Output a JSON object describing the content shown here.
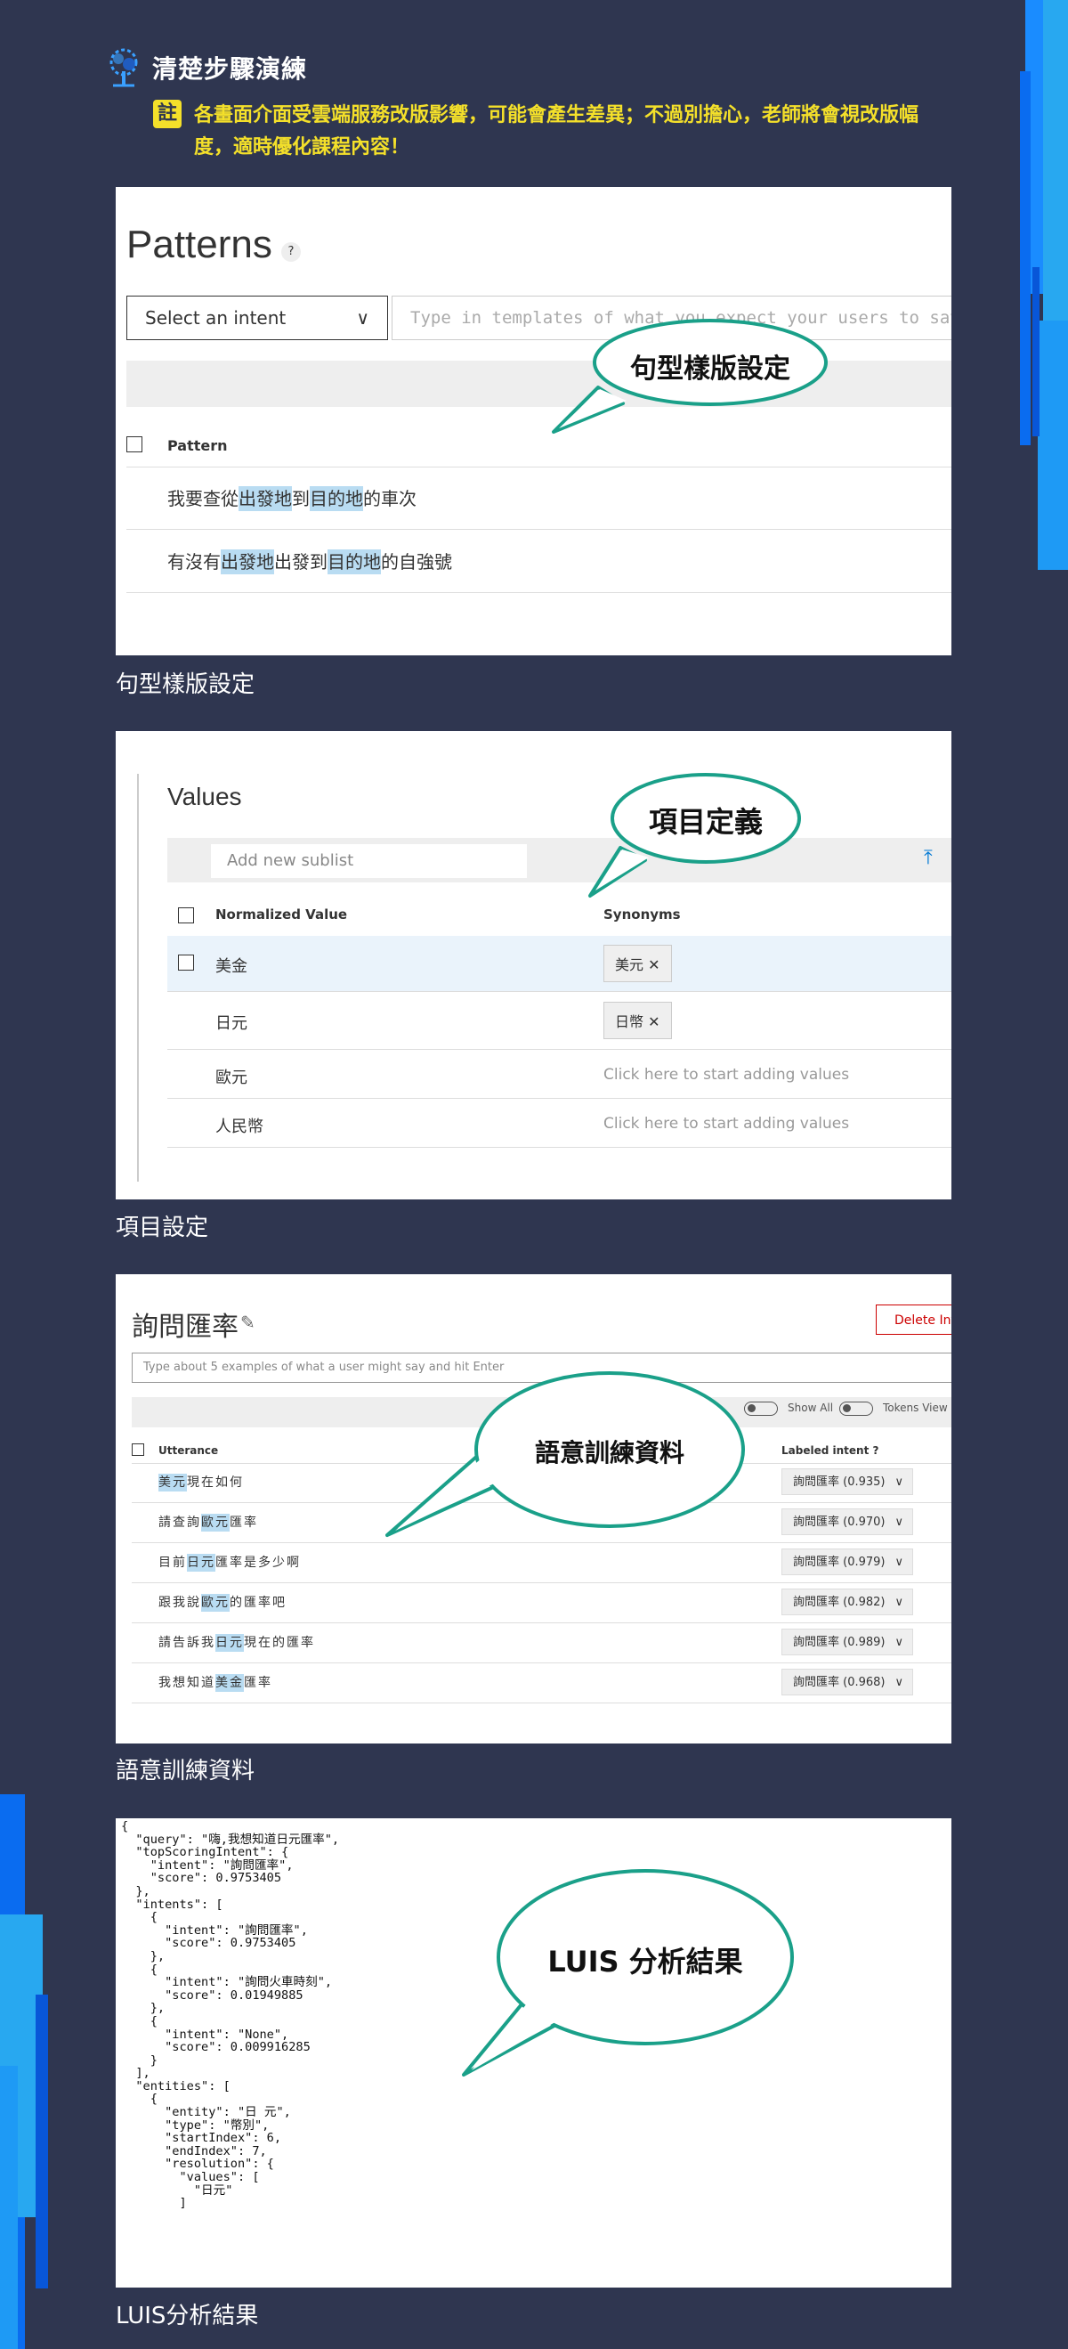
{
  "header": {
    "title": "清楚步驟演練",
    "note_badge": "註",
    "note_text": "各畫面介面受雲端服務改版影響，可能會產生差異；不過別擔心，老師將會視改版幅度，適時優化課程內容！"
  },
  "colors": {
    "background": "#2f3650",
    "accent_yellow": "#f4e02a",
    "bubble_border": "#1aa089",
    "deco_blue": "#0a6cf0"
  },
  "sections": [
    {
      "caption": "句型樣版設定",
      "bubble": "句型樣版設定",
      "screen": {
        "title": "Patterns",
        "help": "?",
        "select": "Select an intent",
        "input_placeholder": "Type in templates of what you expect your users to say",
        "column": "Pattern",
        "rows": [
          {
            "pre": "我要查從",
            "e1": "出發地",
            "mid": "到",
            "e2": "目的地",
            "post": "的車次"
          },
          {
            "pre": "有沒有",
            "e1": "出發地",
            "mid": "出發到",
            "e2": "目的地",
            "post": "的自強號"
          }
        ]
      }
    },
    {
      "caption": "項目設定",
      "bubble": "項目定義",
      "screen": {
        "title": "Values",
        "add_placeholder": "Add new sublist",
        "col_value": "Normalized Value",
        "col_syn": "Synonyms",
        "rows": [
          {
            "value": "美金",
            "synonym": "美元"
          },
          {
            "value": "日元",
            "synonym": "日幣"
          },
          {
            "value": "歐元",
            "placeholder": "Click here to start adding values"
          },
          {
            "value": "人民幣",
            "placeholder": "Click here to start adding values"
          }
        ]
      }
    },
    {
      "caption": "語意訓練資料",
      "bubble": "語意訓練資料",
      "screen": {
        "title": "詢問匯率",
        "delete": "Delete Inte",
        "input_placeholder": "Type about 5 examples of what a user might say and hit Enter",
        "show_all": "Show All",
        "tokens_view": "Tokens View",
        "col_utterance": "Utterance",
        "col_label": "Labeled intent",
        "rows": [
          {
            "pre": "",
            "e": "美元",
            "post": "現在如何",
            "label": "詢問匯率 (0.935)"
          },
          {
            "pre": "請查詢",
            "e": "歐元",
            "post": "匯率",
            "label": "詢問匯率 (0.970)"
          },
          {
            "pre": "目前",
            "e": "日元",
            "post": "匯率是多少啊",
            "label": "詢問匯率 (0.979)"
          },
          {
            "pre": "跟我說",
            "e": "歐元",
            "post": "的匯率吧",
            "label": "詢問匯率 (0.982)"
          },
          {
            "pre": "請告訴我",
            "e": "日元",
            "post": "現在的匯率",
            "label": "詢問匯率 (0.989)"
          },
          {
            "pre": "我想知道",
            "e": "美金",
            "post": "匯率",
            "label": "詢問匯率 (0.968)"
          }
        ]
      }
    },
    {
      "caption": "LUIS分析結果",
      "bubble": "LUIS 分析結果",
      "screen": {
        "json": "{\n  \"query\": \"嗨,我想知道日元匯率\",\n  \"topScoringIntent\": {\n    \"intent\": \"詢問匯率\",\n    \"score\": 0.9753405\n  },\n  \"intents\": [\n    {\n      \"intent\": \"詢問匯率\",\n      \"score\": 0.9753405\n    },\n    {\n      \"intent\": \"詢問火車時刻\",\n      \"score\": 0.01949885\n    },\n    {\n      \"intent\": \"None\",\n      \"score\": 0.009916285\n    }\n  ],\n  \"entities\": [\n    {\n      \"entity\": \"日 元\",\n      \"type\": \"幣別\",\n      \"startIndex\": 6,\n      \"endIndex\": 7,\n      \"resolution\": {\n        \"values\": [\n          \"日元\"\n        ]"
      }
    }
  ]
}
